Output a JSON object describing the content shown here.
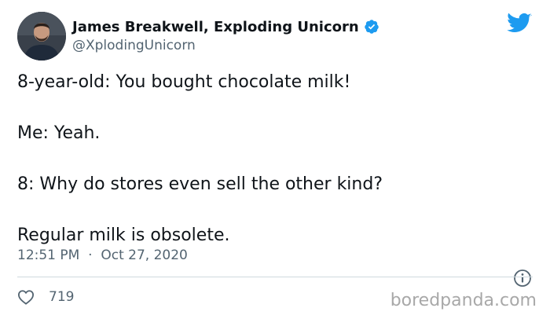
{
  "tweet": {
    "author": {
      "name": "James Breakwell, Exploding Unicorn",
      "handle": "@XplodingUnicorn",
      "verified": true
    },
    "lines": [
      "8-year-old: You bought chocolate milk!",
      "Me: Yeah.",
      "8: Why do stores even sell the other kind?",
      "Regular milk is obsolete."
    ],
    "time": "12:51 PM",
    "separator": "·",
    "date": "Oct 27, 2020",
    "likes": "719"
  },
  "watermark": "boredpanda.com",
  "icons": {
    "brand": "twitter-bird-icon",
    "verified": "verified-badge-icon",
    "info": "info-icon",
    "like": "heart-icon"
  },
  "colors": {
    "twitter_blue": "#1d9bf0",
    "secondary_text": "#536471",
    "primary_text": "#0f1419",
    "divider": "#cfd9de",
    "watermark": "#a8a8a8"
  }
}
